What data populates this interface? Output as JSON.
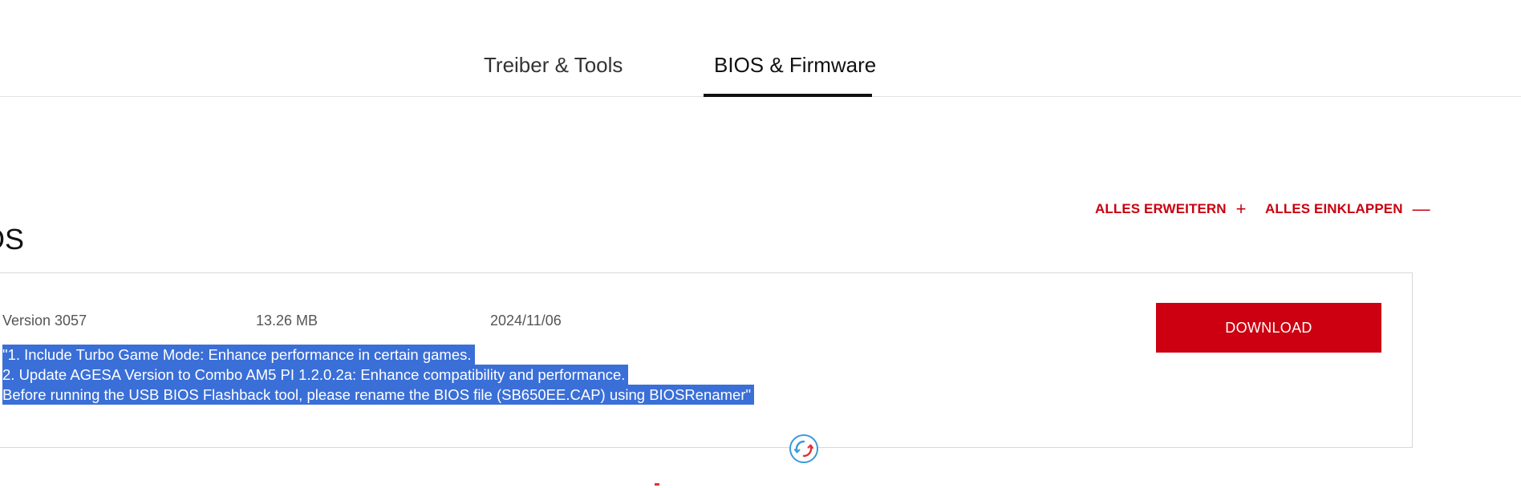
{
  "tabs": {
    "drivers_label": "Treiber & Tools",
    "bios_label": "BIOS & Firmware",
    "active": "BIOS & Firmware"
  },
  "controls": {
    "expand_label": "ALLES ERWEITERN",
    "expand_symbol": "+",
    "collapse_label": "ALLES EINKLAPPEN",
    "collapse_symbol": "—"
  },
  "section": {
    "title": "OS"
  },
  "item": {
    "version": "Version 3057",
    "size": "13.26 MB",
    "date": "2024/11/06",
    "download_label": "DOWNLOAD",
    "description_lines": [
      "\"1. Include Turbo Game Mode: Enhance performance in certain games.",
      "2. Update AGESA Version to Combo AM5 PI 1.2.0.2a: Enhance compatibility and performance.",
      "Before running the USB BIOS Flashback tool, please rename the BIOS file (SB650EE.CAP) using BIOSRenamer\""
    ]
  },
  "colors": {
    "accent_red": "#cc0010",
    "selection_blue": "#3a6fd8",
    "widget_blue": "#3a9ad8"
  },
  "icons": {
    "refresh": "refresh-icon",
    "plus": "plus-icon",
    "minus": "minus-icon"
  }
}
